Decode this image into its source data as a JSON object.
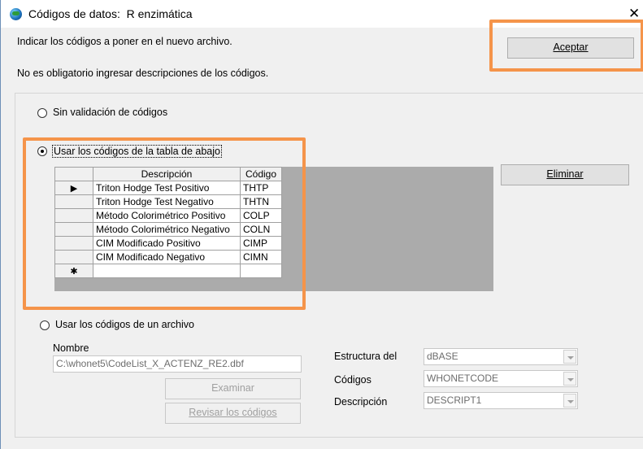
{
  "window": {
    "title": "Códigos de datos:  R enzimática",
    "close_glyph": "✕"
  },
  "header": {
    "line1": "Indicar los códigos a poner en el nuevo archivo.",
    "line2": "No es obligatorio ingresar descripciones de los códigos."
  },
  "buttons": {
    "accept": "Aceptar",
    "delete": "Eliminar",
    "browse": "Examinar",
    "review": "Revisar los códigos"
  },
  "options": {
    "no_validation": "Sin validación de códigos",
    "use_table": "Usar los códigos de la tabla de abajo",
    "use_file": "Usar los códigos de un archivo"
  },
  "table": {
    "headers": [
      "Descripción",
      "Código"
    ],
    "rows": [
      {
        "desc": "Triton Hodge Test Positivo",
        "code": "THTP",
        "marker": "▶"
      },
      {
        "desc": "Triton Hodge Test Negativo",
        "code": "THTN",
        "marker": ""
      },
      {
        "desc": "Método Colorimétrico Positivo",
        "code": "COLP",
        "marker": ""
      },
      {
        "desc": "Método Colorimétrico Negativo",
        "code": "COLN",
        "marker": ""
      },
      {
        "desc": "CIM Modificado Positivo",
        "code": "CIMP",
        "marker": ""
      },
      {
        "desc": "CIM Modificado Negativo",
        "code": "CIMN",
        "marker": ""
      }
    ],
    "new_row_marker": "✱"
  },
  "file": {
    "name_label": "Nombre",
    "name_value": "C:\\whonet5\\CodeList_X_ACTENZ_RE2.dbf",
    "structure_label": "Estructura del",
    "structure_value": "dBASE",
    "codes_label": "Códigos",
    "codes_value": "WHONETCODE",
    "desc_label": "Descripción",
    "desc_value": "DESCRIPT1"
  },
  "colors": {
    "highlight": "#f5944a",
    "grid_background": "#ababab"
  }
}
